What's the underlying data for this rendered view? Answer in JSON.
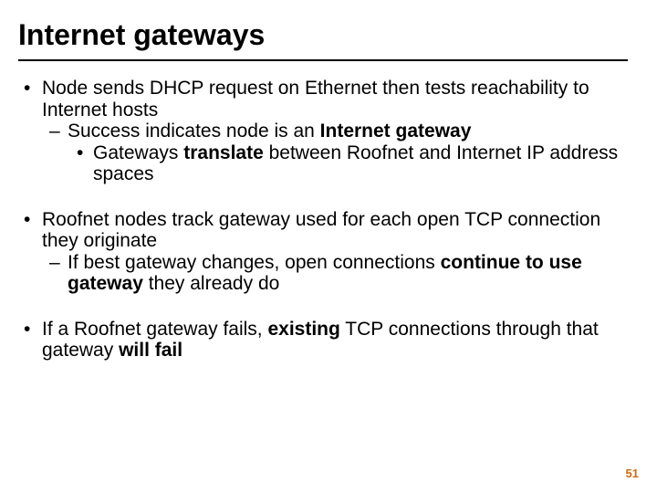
{
  "title": "Internet gateways",
  "bullets": {
    "b1": {
      "text": "Node sends DHCP request on Ethernet then tests reachability to Internet hosts",
      "sub1": {
        "prefix": "Success indicates node is an ",
        "bold": "Internet gateway",
        "sub2": {
          "p1": "Gateways ",
          "b1": "translate",
          "p2": " between Roofnet and Internet IP address spaces"
        }
      }
    },
    "b2": {
      "text": "Roofnet nodes track gateway used for each open TCP connection they originate",
      "sub1": {
        "p1": "If best gateway changes, open connections ",
        "b1": "continue to use gateway",
        "p2": " they already do"
      }
    },
    "b3": {
      "p1": "If a Roofnet gateway fails, ",
      "b1": "existing",
      "p2": " TCP connections through that gateway ",
      "b2": "will fail"
    }
  },
  "page_number": "51"
}
